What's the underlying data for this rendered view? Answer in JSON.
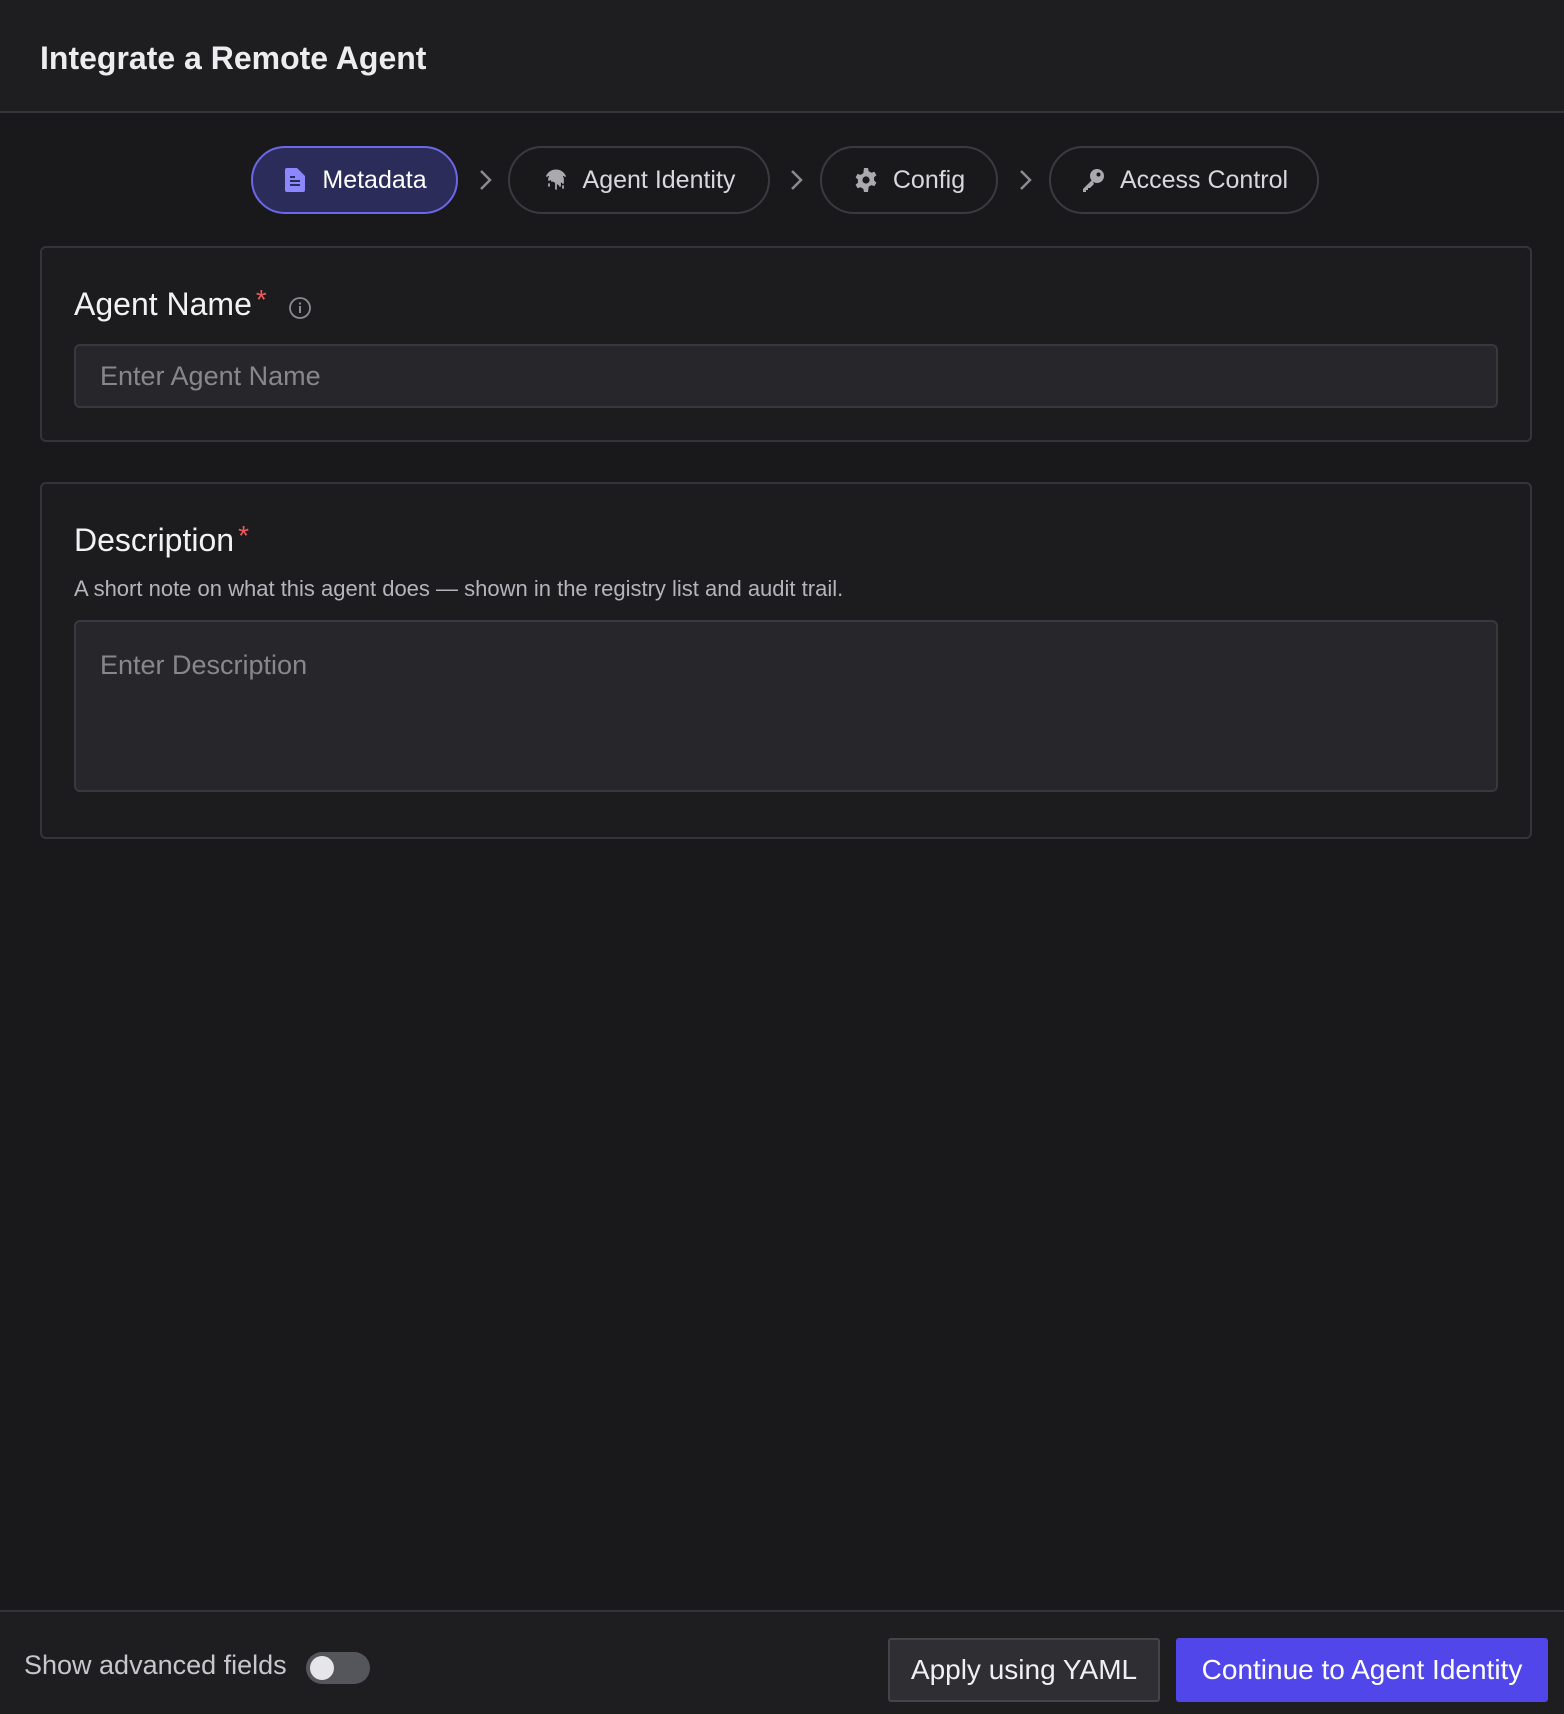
{
  "dialog": {
    "title": "Integrate a Remote Agent"
  },
  "stepper": {
    "steps": [
      {
        "label": "Metadata",
        "icon": "document-icon",
        "active": true
      },
      {
        "label": "Agent Identity",
        "icon": "fingerprint-icon",
        "active": false
      },
      {
        "label": "Config",
        "icon": "gear-icon",
        "active": false
      },
      {
        "label": "Access Control",
        "icon": "key-icon",
        "active": false
      }
    ],
    "separator_icon": "chevron-right-icon"
  },
  "form": {
    "agent_name": {
      "label": "Agent Name",
      "required_marker": "*",
      "placeholder": "Enter Agent Name",
      "value": "",
      "info_icon": "info-icon"
    },
    "description": {
      "label": "Description",
      "required_marker": "*",
      "help_text": "A short note on what this agent does — shown in the registry list and audit trail.",
      "placeholder": "Enter Description",
      "value": ""
    }
  },
  "footer": {
    "advanced_toggle_label": "Show advanced fields",
    "advanced_toggle_on": false,
    "secondary_button": "Apply using YAML",
    "primary_button": "Continue to Agent Identity"
  },
  "colors": {
    "background": "#19191c",
    "accent": "#5146ea",
    "active_step_bg": "#2c2c5a",
    "active_step_border": "#6b67e6",
    "required": "#ef5a5a"
  }
}
